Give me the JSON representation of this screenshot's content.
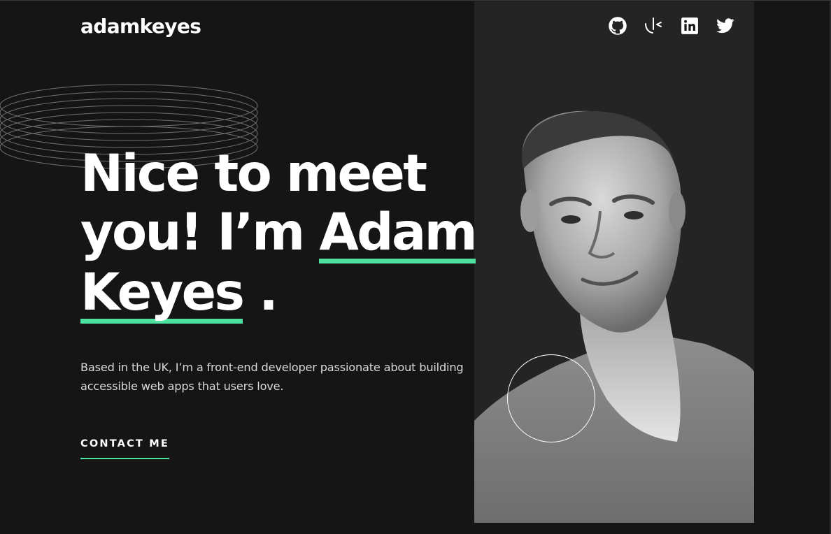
{
  "header": {
    "logo": "adamkeyes",
    "social_links": [
      {
        "name": "github",
        "icon": "github-icon"
      },
      {
        "name": "frontend-mentor",
        "icon": "frontend-mentor-icon"
      },
      {
        "name": "linkedin",
        "icon": "linkedin-icon"
      },
      {
        "name": "twitter",
        "icon": "twitter-icon"
      }
    ]
  },
  "hero": {
    "headline": {
      "line1": "Nice to meet",
      "line2_prefix": "you! I’m ",
      "name_first": "Adam",
      "name_last": "Keyes",
      "period": " ."
    },
    "bio": "Based in the UK, I’m a front-end developer passionate about building accessible web apps that users love.",
    "cta": "CONTACT ME",
    "photo_alt": "portrait-photo"
  },
  "colors": {
    "background": "#151515",
    "panel": "#242424",
    "accent": "#4ee1a0",
    "text": "#ffffff",
    "muted": "#d9d9d9"
  }
}
